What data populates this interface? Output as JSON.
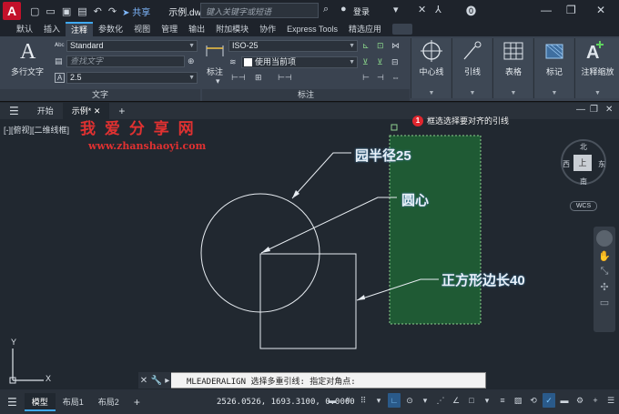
{
  "titlebar": {
    "logo": "A",
    "share_label": "共享",
    "doc_title": "示例.dwg",
    "search_placeholder": "键入关键字或短语",
    "login_label": "登录",
    "help_label": "?"
  },
  "ribbon_tabs": [
    "默认",
    "插入",
    "注释",
    "参数化",
    "视图",
    "管理",
    "输出",
    "附加模块",
    "协作",
    "Express Tools",
    "精选应用"
  ],
  "ribbon_active_tab": "注释",
  "ribbon": {
    "text_panel": {
      "multiline_label": "多行文字",
      "style_value": "Standard",
      "find_placeholder": "查找文字",
      "height_value": "2.5",
      "panel_label": "文字"
    },
    "dim_panel": {
      "dim_label": "标注",
      "dim_style_value": "ISO-25",
      "layer_value": "使用当前项",
      "panel_label": "标注"
    },
    "big_buttons": [
      {
        "label": "中心线"
      },
      {
        "label": "引线"
      },
      {
        "label": "表格"
      },
      {
        "label": "标记"
      },
      {
        "label": "注释缩放"
      }
    ]
  },
  "file_tabs": {
    "start": "开始",
    "active": "示例*",
    "add": "+"
  },
  "viewport": {
    "label": "[-][俯视][二维线框]",
    "watermark_title": "我 爱 分 享 网",
    "watermark_url": "www.zhanshaoyi.com",
    "tip_number": "1",
    "tip_text": "框选选择要对齐的引线",
    "leader_labels": [
      "园半径25",
      "圆心",
      "正方形边长40"
    ],
    "viewcube": {
      "north": "北",
      "south": "南",
      "west": "西",
      "east": "东",
      "face": "上",
      "wcs": "WCS"
    },
    "ucs_y": "Y",
    "ucs_x": "X"
  },
  "command_line": {
    "text": "MLEADERALIGN 选择多重引线: 指定对角点:"
  },
  "status": {
    "tabs": [
      "模型",
      "布局1",
      "布局2"
    ],
    "active_tab": "模型",
    "coords": "2526.0526, 1693.3100, 0.0000"
  },
  "colors": {
    "accent": "#3fa9f5",
    "green_box": "#1f5a34",
    "leader_text": "#e8f0f8"
  }
}
